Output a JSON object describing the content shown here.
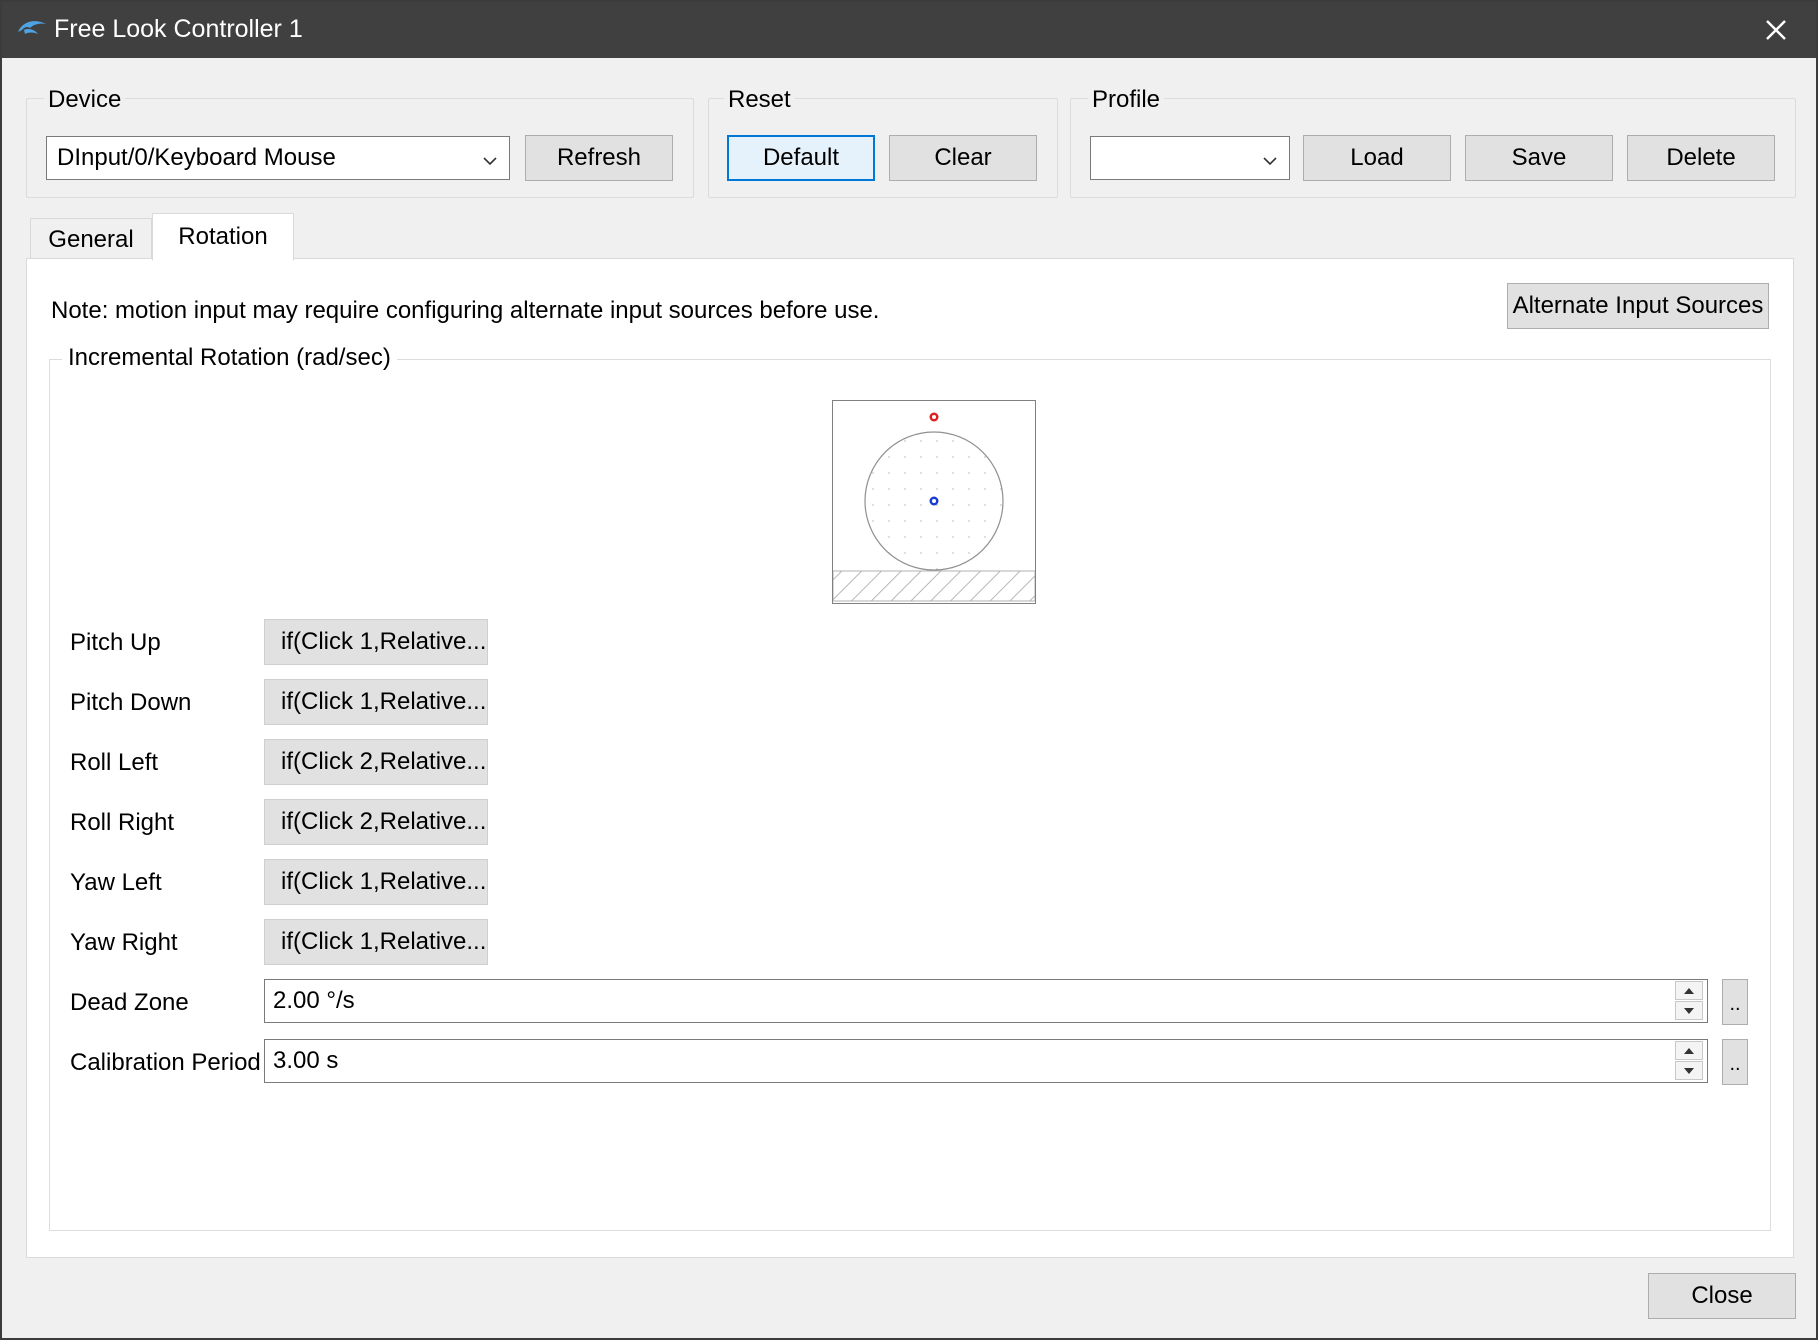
{
  "window": {
    "title": "Free Look Controller 1"
  },
  "device": {
    "group_label": "Device",
    "selected": "DInput/0/Keyboard Mouse",
    "refresh_label": "Refresh"
  },
  "reset": {
    "group_label": "Reset",
    "default_label": "Default",
    "clear_label": "Clear"
  },
  "profile": {
    "group_label": "Profile",
    "selected": "",
    "load_label": "Load",
    "save_label": "Save",
    "delete_label": "Delete"
  },
  "tabs": [
    {
      "label": "General",
      "active": false
    },
    {
      "label": "Rotation",
      "active": true
    }
  ],
  "rotation": {
    "note": "Note: motion input may require configuring alternate input sources before use.",
    "alt_input_label": "Alternate Input Sources",
    "group_label": "Incremental Rotation (rad/sec)",
    "mappings": [
      {
        "label": "Pitch Up",
        "value": "if(Click 1,Relative..."
      },
      {
        "label": "Pitch Down",
        "value": "if(Click 1,Relative..."
      },
      {
        "label": "Roll Left",
        "value": "if(Click 2,Relative..."
      },
      {
        "label": "Roll Right",
        "value": "if(Click 2,Relative..."
      },
      {
        "label": "Yaw Left",
        "value": "if(Click 1,Relative..."
      },
      {
        "label": "Yaw Right",
        "value": "if(Click 1,Relative..."
      }
    ],
    "dead_zone": {
      "label": "Dead Zone",
      "value": "2.00 °/s",
      "more_label": ".."
    },
    "calibration": {
      "label": "Calibration Period",
      "value": "3.00 s",
      "more_label": ".."
    }
  },
  "footer": {
    "close_label": "Close"
  },
  "colors": {
    "accent": "#0078d7",
    "titlebar": "#404040",
    "indicator_red": "#e02020",
    "indicator_blue": "#1a3cd0"
  }
}
